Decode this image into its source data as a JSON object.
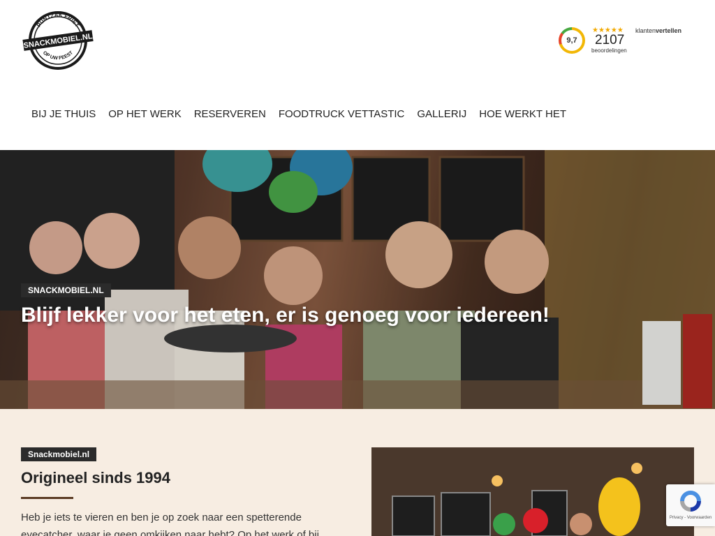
{
  "header": {
    "logo": {
      "arc_top": "PUNTZAK FRIET",
      "band": "SNACKMOBIEL.NL",
      "arc_bottom": "OP UW FEEST"
    },
    "rating": {
      "score": "9,7",
      "stars": "★★★★★",
      "count": "2107",
      "count_label": "beoordelingen",
      "brand_prefix": "klanten",
      "brand_suffix": "vertellen"
    },
    "nav": [
      {
        "label": "BIJ JE THUIS"
      },
      {
        "label": "OP HET WERK"
      },
      {
        "label": "RESERVEREN"
      },
      {
        "label": "FOODTRUCK VETTASTIC"
      },
      {
        "label": "GALLERIJ"
      },
      {
        "label": "HOE WERKT HET"
      }
    ]
  },
  "hero": {
    "badge": "SNACKMOBIEL.NL",
    "title": "Blijf lekker voor het eten, er is genoeg voor iedereen!"
  },
  "content": {
    "badge": "Snackmobiel.nl",
    "title": "Origineel sinds 1994",
    "text": "Heb je iets te vieren en ben je op zoek naar een spetterende eyecatcher, waar je geen omkijken naar hebt? Op het werk of bij"
  },
  "recaptcha": {
    "text": "Privacy - Voorwaarden"
  },
  "colors": {
    "badge_bg": "#2b2b2b",
    "content_bg": "#f7ede2",
    "rule": "#5a3a22",
    "rating_star": "#f2a900"
  }
}
